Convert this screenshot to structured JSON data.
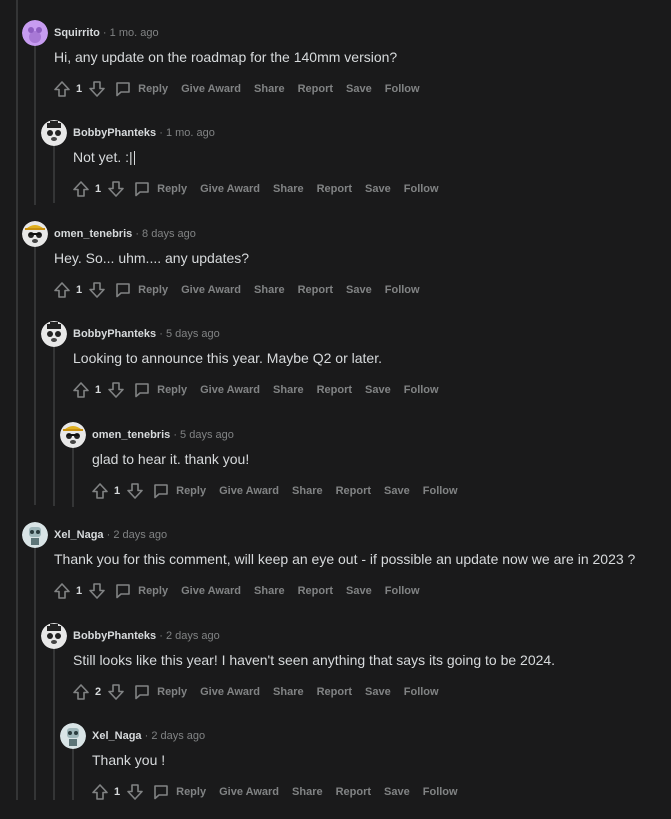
{
  "actions": {
    "reply": "Reply",
    "give_award": "Give Award",
    "share": "Share",
    "report": "Report",
    "save": "Save",
    "follow": "Follow"
  },
  "separator": "·",
  "comments": [
    {
      "author": "Squirrito",
      "time": "1 mo. ago",
      "body": "Hi, any update on the roadmap for the 140mm version?",
      "votes": "1",
      "avatar_icon": "purple-avatar-icon"
    },
    {
      "author": "BobbyPhanteks",
      "time": "1 mo. ago",
      "body": "Not yet. :|",
      "votes": "1",
      "avatar_icon": "panda-avatar-icon"
    },
    {
      "author": "omen_tenebris",
      "time": "8 days ago",
      "body": "Hey. So... uhm.... any updates?",
      "votes": "1",
      "avatar_icon": "panda-hat-avatar-icon"
    },
    {
      "author": "BobbyPhanteks",
      "time": "5 days ago",
      "body": "Looking to announce this year. Maybe Q2 or later.",
      "votes": "1",
      "avatar_icon": "panda-avatar-icon"
    },
    {
      "author": "omen_tenebris",
      "time": "5 days ago",
      "body": "glad to hear it. thank you!",
      "votes": "1",
      "avatar_icon": "panda-hat-avatar-icon"
    },
    {
      "author": "Xel_Naga",
      "time": "2 days ago",
      "body": "Thank you for this comment, will keep an eye out - if possible an update now we are in 2023 ?",
      "votes": "1",
      "avatar_icon": "robot-avatar-icon"
    },
    {
      "author": "BobbyPhanteks",
      "time": "2 days ago",
      "body": "Still looks like this year! I haven't seen anything that says its going to be 2024.",
      "votes": "2",
      "avatar_icon": "panda-avatar-icon"
    },
    {
      "author": "Xel_Naga",
      "time": "2 days ago",
      "body": "Thank you !",
      "votes": "1",
      "avatar_icon": "robot-avatar-icon"
    }
  ],
  "colors": {
    "background": "#1a1a1b",
    "text": "#d7dadc",
    "muted": "#818384",
    "thread_line": "#343536"
  }
}
